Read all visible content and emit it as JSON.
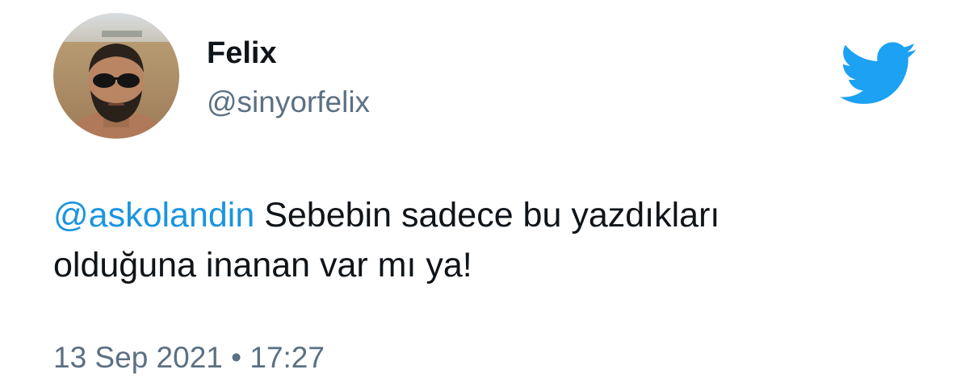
{
  "user": {
    "display_name": "Felix",
    "handle": "@sinyorfelix"
  },
  "tweet": {
    "mention": "@askolandin",
    "text_line1": " Sebebin sadece bu yazdıkları",
    "text_line2": "olduğuna inanan var mı ya!",
    "timestamp": "13 Sep 2021 • 17:27"
  },
  "icons": {
    "logo": "twitter-bird-icon"
  },
  "colors": {
    "twitter_blue": "#1da1f2",
    "link_blue": "#1b95e0",
    "secondary_text": "#5b7083",
    "primary_text": "#0f1419"
  }
}
